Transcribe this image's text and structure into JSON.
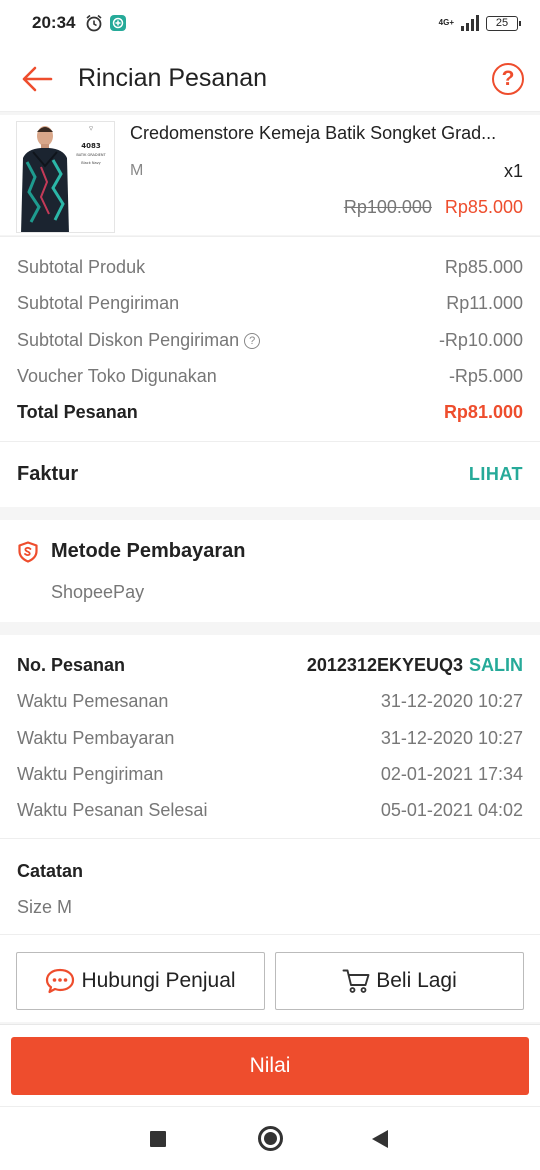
{
  "status_bar": {
    "time": "20:34",
    "network": "4G+",
    "battery": "25"
  },
  "header": {
    "title": "Rincian Pesanan",
    "help_icon": "?"
  },
  "product": {
    "name": "Credomenstore Kemeja Batik Songket Grad...",
    "variant": "M",
    "quantity": "x1",
    "original_price": "Rp100.000",
    "price": "Rp85.000",
    "thumbnail_text": {
      "code": "4083",
      "line2": "BATIK GRADIENT",
      "line3": "Black Navy"
    }
  },
  "summary": {
    "rows": [
      {
        "label": "Subtotal Produk",
        "value": "Rp85.000"
      },
      {
        "label": "Subtotal Pengiriman",
        "value": "Rp11.000"
      },
      {
        "label": "Subtotal Diskon Pengiriman",
        "value": "-Rp10.000"
      },
      {
        "label": "Voucher Toko Digunakan",
        "value": "-Rp5.000"
      }
    ],
    "total": {
      "label": "Total Pesanan",
      "value": "Rp81.000"
    }
  },
  "invoice": {
    "label": "Faktur",
    "link": "LIHAT"
  },
  "payment": {
    "label": "Metode Pembayaran",
    "method": "ShopeePay"
  },
  "order": {
    "number_label": "No. Pesanan",
    "number": "2012312EKYEUQ3",
    "copy_label": "SALIN",
    "rows": [
      {
        "label": "Waktu Pemesanan",
        "value": "31-12-2020 10:27"
      },
      {
        "label": "Waktu Pembayaran",
        "value": "31-12-2020 10:27"
      },
      {
        "label": "Waktu Pengiriman",
        "value": "02-01-2021 17:34"
      },
      {
        "label": "Waktu Pesanan Selesai",
        "value": "05-01-2021 04:02"
      }
    ]
  },
  "notes": {
    "label": "Catatan",
    "text": "Size M"
  },
  "actions": {
    "contact_seller": "Hubungi Penjual",
    "buy_again": "Beli Lagi"
  },
  "primary_action": {
    "label": "Nilai"
  },
  "colors": {
    "accent": "#ee4d2d",
    "link": "#26aa99"
  }
}
